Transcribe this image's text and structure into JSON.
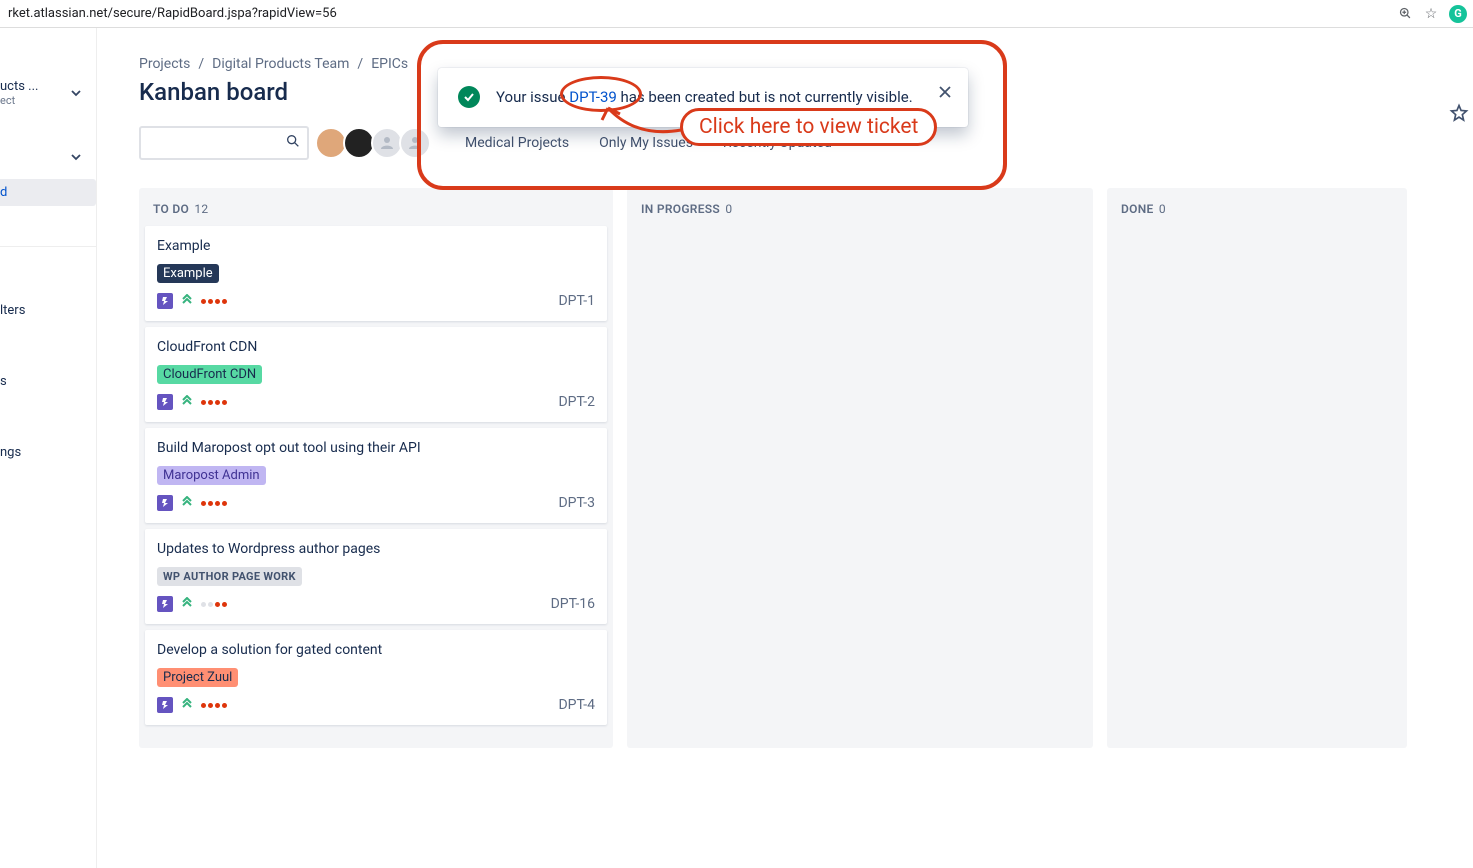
{
  "url": "rket.atlassian.net/secure/RapidBoard.jspa?rapidView=56",
  "sidebar": {
    "project_name": "ucts ...",
    "project_sub": "ect",
    "items": [
      {
        "label": "d",
        "active": true
      },
      {
        "label": ""
      },
      {
        "label": "lters"
      },
      {
        "label": "s"
      },
      {
        "label": "ngs"
      }
    ]
  },
  "breadcrumb": {
    "items": [
      "Projects",
      "Digital Products Team",
      "EPICs"
    ]
  },
  "page_title": "Kanban board",
  "quick_filters": [
    "Medical Projects",
    "Only My Issues",
    "Recently Updated"
  ],
  "flag": {
    "pre": "Your issue ",
    "link": "DPT-39",
    "post": " has been created but is not currently visible."
  },
  "annotation": {
    "label": "Click here to view ticket"
  },
  "columns": {
    "todo": {
      "name": "TO DO",
      "count": "12"
    },
    "progress": {
      "name": "IN PROGRESS",
      "count": "0"
    },
    "done": {
      "name": "DONE",
      "count": "0"
    }
  },
  "cards": [
    {
      "title": "Example",
      "epic": "Example",
      "epic_class": "epic-dark",
      "key": "DPT-1",
      "dots": "rrrr"
    },
    {
      "title": "CloudFront CDN",
      "epic": "CloudFront CDN",
      "epic_class": "epic-green",
      "key": "DPT-2",
      "dots": "rrrr"
    },
    {
      "title": "Build Maropost opt out tool using their API",
      "epic": "Maropost Admin",
      "epic_class": "epic-purple",
      "key": "DPT-3",
      "dots": "rrrr"
    },
    {
      "title": "Updates to Wordpress author pages",
      "epic": "WP AUTHOR PAGE WORK",
      "epic_class": "epic-grey",
      "key": "DPT-16",
      "dots": "ggrr"
    },
    {
      "title": "Develop a solution for gated content",
      "epic": "Project Zuul",
      "epic_class": "epic-orange",
      "key": "DPT-4",
      "dots": "rrrr"
    }
  ]
}
